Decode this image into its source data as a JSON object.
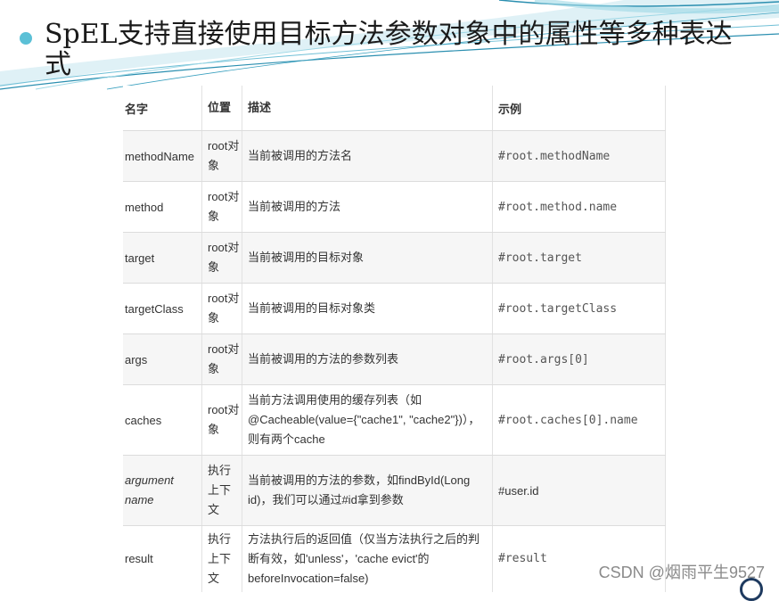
{
  "slide": {
    "title": "SpEL支持直接使用目标方法参数对象中的属性等多种表达式"
  },
  "table": {
    "headers": {
      "name": "名字",
      "position": "位置",
      "description": "描述",
      "example": "示例"
    },
    "rows": [
      {
        "name": "methodName",
        "position": "root对象",
        "description": "当前被调用的方法名",
        "example": "#root.methodName"
      },
      {
        "name": "method",
        "position": "root对象",
        "description": "当前被调用的方法",
        "example": "#root.method.name"
      },
      {
        "name": "target",
        "position": "root对象",
        "description": "当前被调用的目标对象",
        "example": "#root.target"
      },
      {
        "name": "targetClass",
        "position": "root对象",
        "description": "当前被调用的目标对象类",
        "example": "#root.targetClass"
      },
      {
        "name": "args",
        "position": "root对象",
        "description": "当前被调用的方法的参数列表",
        "example": "#root.args[0]"
      },
      {
        "name": "caches",
        "position": "root对象",
        "description": "当前方法调用使用的缓存列表（如@Cacheable(value={\"cache1\", \"cache2\"})），则有两个cache",
        "example": "#root.caches[0].name"
      },
      {
        "name": "argument name",
        "position": "执行上下文",
        "description": "当前被调用的方法的参数，如findById(Long id)，我们可以通过#id拿到参数",
        "example": "#user.id"
      },
      {
        "name": "result",
        "position": "执行上下文",
        "description": "方法执行后的返回值（仅当方法执行之后的判断有效，如'unless'，'cache evict'的beforeInvocation=false)",
        "example": "#result"
      }
    ]
  },
  "watermark": "CSDN @烟雨平生9527",
  "colors": {
    "bullet": "#5bc0d6",
    "swoosh_dark": "#2b8fb0",
    "swoosh_light": "#9ed8e6"
  }
}
